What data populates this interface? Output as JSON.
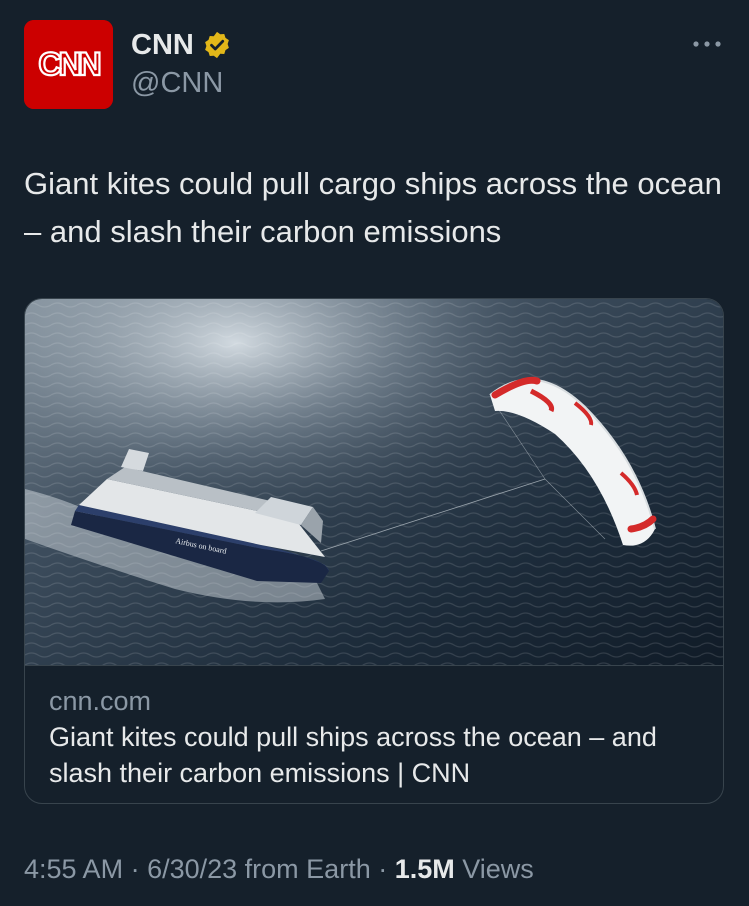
{
  "author": {
    "avatar_text": "CNN",
    "display_name": "CNN",
    "handle": "@CNN",
    "verified_badge": "gold-verified-icon",
    "brand_color": "#cc0000",
    "badge_color": "#e2b719"
  },
  "menu_icon": "more-horizontal-icon",
  "tweet": {
    "text": "Giant kites could pull cargo ships across the ocean – and slash their carbon emissions"
  },
  "card": {
    "image_caption_on_ship": "Airbus on board",
    "domain": "cnn.com",
    "title": "Giant kites could pull ships across the ocean – and slash their carbon emissions | CNN"
  },
  "meta": {
    "time": "4:55 AM",
    "separator": " · ",
    "date": "6/30/23",
    "source": "from Earth",
    "views_count": "1.5M",
    "views_label": "Views"
  },
  "colors": {
    "background": "#15202b",
    "text_primary": "#e7e9ea",
    "text_secondary": "#8b98a5",
    "border": "#38444d"
  }
}
